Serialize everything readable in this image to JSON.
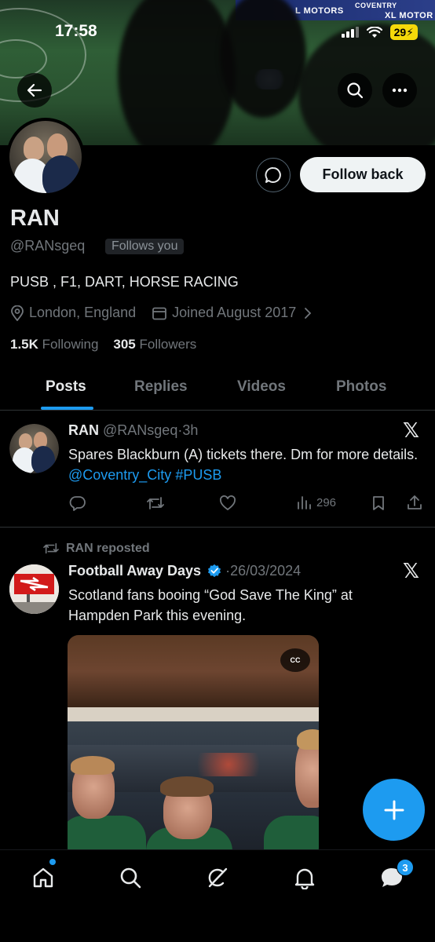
{
  "status_bar": {
    "time": "17:58",
    "battery": "29"
  },
  "banner": {
    "ad_left": "L MOTORS",
    "ad_mid": "COVENTRY",
    "ad_right": "XL MOTOR"
  },
  "profile": {
    "name": "RAN",
    "handle": "@RANsgeq",
    "follows_you": "Follows you",
    "bio": "PUSB , F1, DART, HORSE RACING",
    "location": "London, England",
    "joined": "Joined August 2017",
    "following_count": "1.5K",
    "following_label": "Following",
    "followers_count": "305",
    "followers_label": "Followers",
    "follow_button": "Follow back"
  },
  "tabs": [
    "Posts",
    "Replies",
    "Videos",
    "Photos"
  ],
  "active_tab": "Posts",
  "posts": [
    {
      "author": "RAN",
      "handle": "@RANsgeq",
      "sep": "·",
      "time": "3h",
      "text_plain": "Spares Blackburn (A) tickets there. Dm for more details.",
      "mention": "@Coventry_City",
      "hashtag": "#PUSB",
      "views": "296"
    },
    {
      "repost_label": "RAN reposted",
      "author": "Football Away Days",
      "sep": "·",
      "time": "26/03/2024",
      "text": "Scotland fans booing “God Save The King” at Hampden Park this evening.",
      "media_cc": "CC"
    }
  ],
  "bottom_nav": {
    "items": [
      "home-icon",
      "search-icon",
      "grok-icon",
      "notifications-icon",
      "messages-icon"
    ],
    "messages_badge": "3"
  },
  "colors": {
    "accent": "#1d9bf0",
    "background": "#000000",
    "secondary_text": "#71767b"
  }
}
